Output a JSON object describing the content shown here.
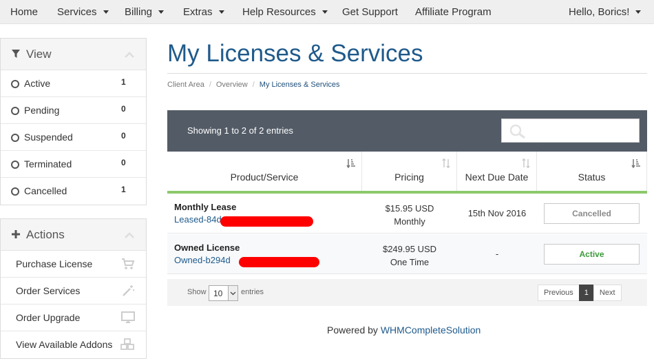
{
  "nav": {
    "home": "Home",
    "services": "Services",
    "billing": "Billing",
    "extras": "Extras",
    "help": "Help Resources",
    "support": "Get Support",
    "affiliate": "Affiliate Program",
    "user": "Hello, Borics!"
  },
  "view_panel": {
    "title": "View",
    "items": [
      {
        "label": "Active",
        "count": "1"
      },
      {
        "label": "Pending",
        "count": "0"
      },
      {
        "label": "Suspended",
        "count": "0"
      },
      {
        "label": "Terminated",
        "count": "0"
      },
      {
        "label": "Cancelled",
        "count": "1"
      }
    ]
  },
  "actions_panel": {
    "title": "Actions",
    "items": [
      {
        "label": "Purchase License",
        "icon": "cart-icon"
      },
      {
        "label": "Order Services",
        "icon": "magic-wand-icon"
      },
      {
        "label": "Order Upgrade",
        "icon": "monitor-icon"
      },
      {
        "label": "View Available Addons",
        "icon": "cubes-icon"
      }
    ]
  },
  "page": {
    "title": "My Licenses & Services",
    "breadcrumb": [
      "Client Area",
      "Overview",
      "My Licenses & Services"
    ]
  },
  "table": {
    "info": "Showing 1 to 2 of 2 entries",
    "search_placeholder": "",
    "columns": [
      "Product/Service",
      "Pricing",
      "Next Due Date",
      "Status"
    ],
    "rows": [
      {
        "product": "Monthly Lease",
        "domain": "Leased-84d",
        "price": "$15.95 USD",
        "cycle": "Monthly",
        "due": "15th Nov 2016",
        "status": "Cancelled",
        "status_color": "#8a8a8a"
      },
      {
        "product": "Owned License",
        "domain": "Owned-b294d",
        "price": "$249.95 USD",
        "cycle": "One Time",
        "due": "-",
        "status": "Active",
        "status_color": "#3c9a3c"
      }
    ],
    "length": {
      "show": "Show",
      "value": "10",
      "entries": "entries"
    },
    "pager": {
      "previous": "Previous",
      "current": "1",
      "next": "Next"
    }
  },
  "footer": {
    "powered_by": "Powered by",
    "brand": "WHMCompleteSolution"
  },
  "colors": {
    "accent": "#1f5a8b",
    "header_bar": "#535b66",
    "green_rule": "#8cc96a",
    "redaction": "#ff0000"
  }
}
